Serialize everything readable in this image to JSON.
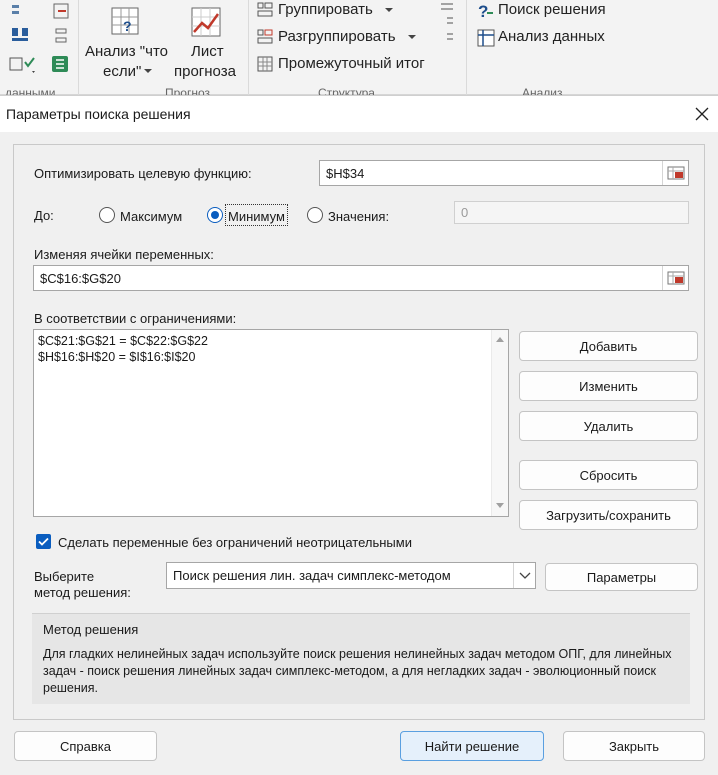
{
  "ribbon": {
    "what_if_line1": "Анализ \"что",
    "what_if_line2": "если\"",
    "forecast_line1": "Лист",
    "forecast_line2": "прогноза",
    "group": "Группировать",
    "ungroup": "Разгруппировать",
    "subtotal": "Промежуточный итог",
    "solver": "Поиск решения",
    "data_analysis": "Анализ данных",
    "group_data_tools": "данными",
    "group_forecast": "Прогноз",
    "group_outline": "Структура",
    "group_analysis": "Анализ"
  },
  "dialog": {
    "title": "Параметры поиска решения",
    "objective_label": "Оптимизировать целевую функцию:",
    "objective_value": "$H$34",
    "to_label": "До:",
    "opt_max": "Максимум",
    "opt_min": "Минимум",
    "opt_value": "Значения:",
    "value_field": "0",
    "variables_label": "Изменяя ячейки переменных:",
    "variables_value": "$C$16:$G$20",
    "constraints_label": "В соответствии с ограничениями:",
    "constraints": [
      "$C$21:$G$21 = $C$22:$G$22",
      "$H$16:$H$20 = $I$16:$I$20"
    ],
    "btn_add": "Добавить",
    "btn_change": "Изменить",
    "btn_delete": "Удалить",
    "btn_reset": "Сбросить",
    "btn_load_save": "Загрузить/сохранить",
    "nonneg_label": "Сделать переменные без ограничений неотрицательными",
    "method_label_line1": "Выберите",
    "method_label_line2": "метод решения:",
    "method_selected": "Поиск решения лин. задач симплекс-методом",
    "btn_options": "Параметры",
    "method_group_title": "Метод решения",
    "method_desc": "Для гладких нелинейных задач используйте поиск решения нелинейных задач методом ОПГ, для линейных задач - поиск решения линейных задач симплекс-методом, а для негладких задач - эволюционный поиск решения.",
    "btn_help": "Справка",
    "btn_solve": "Найти решение",
    "btn_close": "Закрыть"
  },
  "colors": {
    "accent": "#0a5dbf",
    "primary_button_bg": "#e5f0fb"
  },
  "state": {
    "selected_option": "min",
    "nonneg_checked": true
  }
}
